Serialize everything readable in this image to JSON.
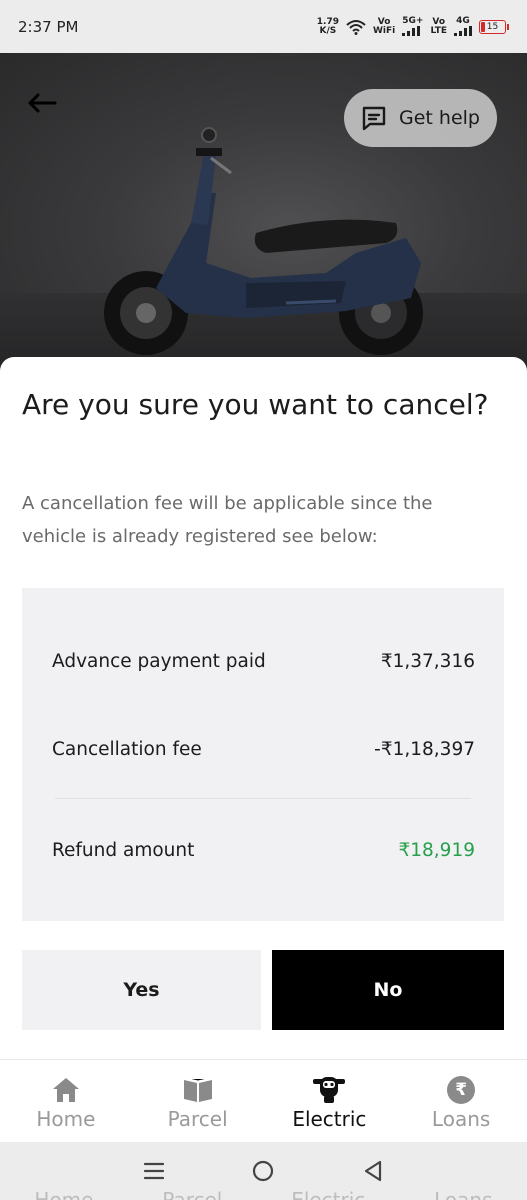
{
  "status_bar": {
    "time": "2:37 PM",
    "net_speed_value": "1.79",
    "net_speed_unit": "K/S",
    "vowifi_top": "Vo",
    "vowifi_bottom": "WiFi",
    "signal1_label": "5G+",
    "volte_top": "Vo",
    "volte_bottom": "LTE",
    "signal2_label": "4G",
    "battery": "15"
  },
  "hero": {
    "help_label": "Get help"
  },
  "sheet": {
    "title": "Are you sure you want to cancel?",
    "description": "A cancellation fee will be applicable since the vehicle is already registered see below:",
    "rows": [
      {
        "label": "Advance payment paid",
        "value": "₹1,37,316"
      },
      {
        "label": "Cancellation fee",
        "value": "-₹1,18,397"
      },
      {
        "label": "Refund amount",
        "value": "₹18,919"
      }
    ],
    "yes_label": "Yes",
    "no_label": "No"
  },
  "bottom_nav": {
    "items": [
      {
        "label": "Home",
        "icon": "home-icon",
        "active": false
      },
      {
        "label": "Parcel",
        "icon": "parcel-icon",
        "active": false
      },
      {
        "label": "Electric",
        "icon": "electric-scooter-icon",
        "active": true
      },
      {
        "label": "Loans",
        "icon": "rupee-icon",
        "active": false
      }
    ]
  },
  "system_nav": {
    "ghost_labels": [
      "Home",
      "Parcel",
      "Electric",
      "Loans"
    ]
  },
  "colors": {
    "refund_green": "#26a04a",
    "battery_red": "#d42a2a",
    "primary_button": "#000000"
  }
}
